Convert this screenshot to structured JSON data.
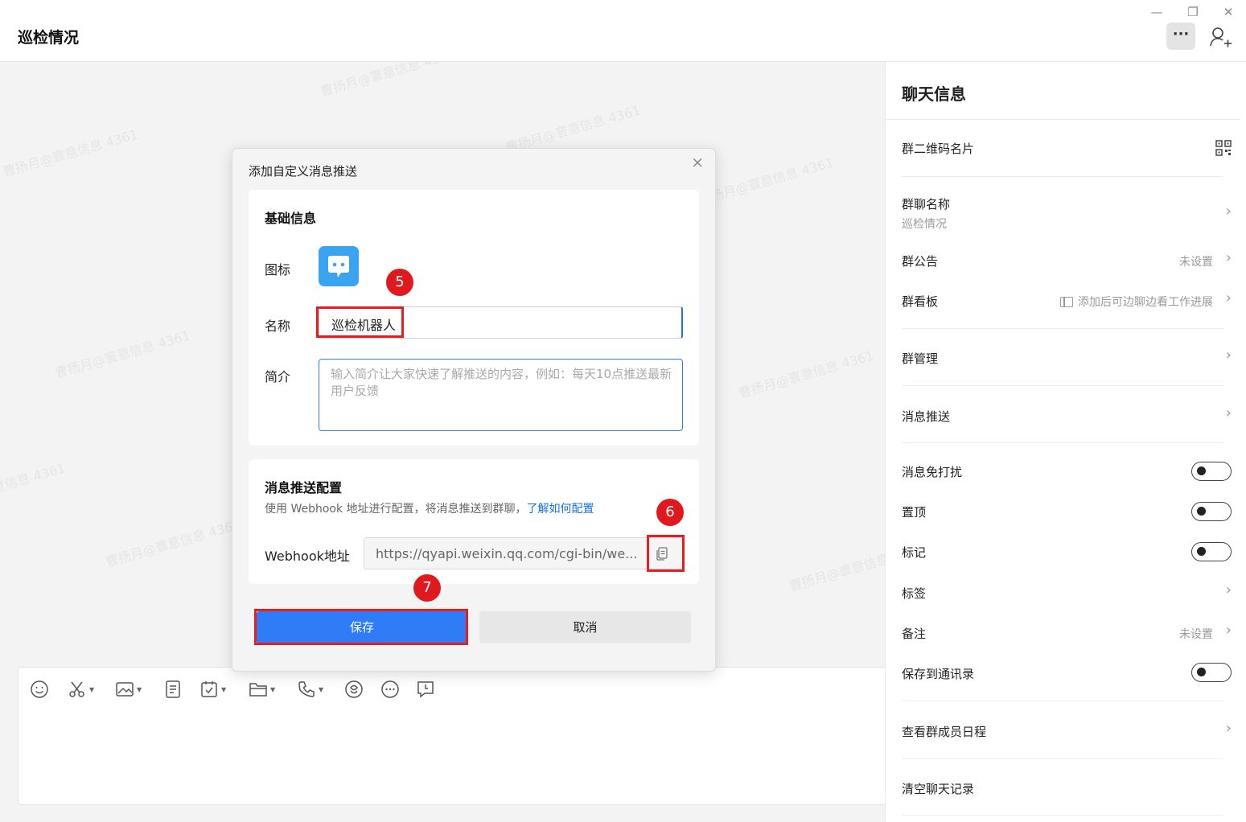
{
  "chat": {
    "title": "巡检情况",
    "watermark": "曹扬月@寰意信息 4361"
  },
  "window_controls": {
    "minimize": "—",
    "restore": "❐",
    "close": "✕"
  },
  "header_actions": {
    "more": "···"
  },
  "sidebar": {
    "title": "聊天信息",
    "qr_card_label": "群二维码名片",
    "group_name_label": "群聊名称",
    "group_name_value": "巡检情况",
    "announcement_label": "群公告",
    "announcement_value": "未设置",
    "board_label": "群看板",
    "board_value": "添加后可边聊边看工作进展",
    "manage_label": "群管理",
    "push_label": "消息推送",
    "dnd_label": "消息免打扰",
    "pin_label": "置顶",
    "mark_label": "标记",
    "tags_label": "标签",
    "remark_label": "备注",
    "remark_value": "未设置",
    "save_contacts_label": "保存到通讯录",
    "schedule_label": "查看群成员日程",
    "clear_label": "清空聊天记录",
    "toggles": {
      "dnd": false,
      "pin": false,
      "mark": false,
      "save_contacts": false
    }
  },
  "dialog": {
    "title": "添加自定义消息推送",
    "basic_section_title": "基础信息",
    "icon_label": "图标",
    "name_label": "名称",
    "name_value": "巡检机器人",
    "intro_label": "简介",
    "intro_placeholder": "输入简介让大家快速了解推送的内容，例如：每天10点推送最新用户反馈",
    "config_section_title": "消息推送配置",
    "config_desc": "使用 Webhook 地址进行配置，将消息推送到群聊，",
    "config_link": "了解如何配置",
    "webhook_label": "Webhook地址",
    "webhook_value": "https://qyapi.weixin.qq.com/cgi-bin/we...",
    "save_label": "保存",
    "cancel_label": "取消"
  },
  "annotations": {
    "step5": "5",
    "step6": "6",
    "step7": "7"
  },
  "colors": {
    "primary": "#2f7cf6",
    "annotation_red": "#e0191f",
    "link": "#1a6fe0"
  }
}
